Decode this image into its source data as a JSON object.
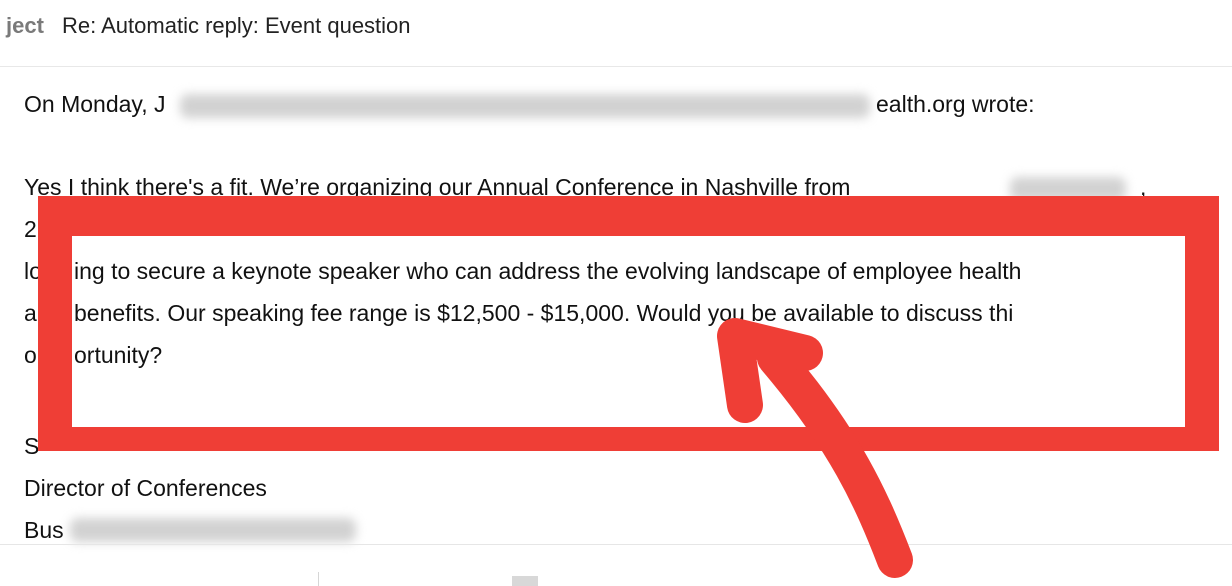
{
  "subject": {
    "label": "ject",
    "text": "Re: Automatic reply: Event question"
  },
  "email": {
    "header_start": "On Monday, J",
    "header_end": "ealth.org wrote:",
    "line1_start": "Yes I think there's a fit. We’re organizing our Annual Conference in Nashville from",
    "line1_end": ",",
    "line2_start": "2",
    "line3_start": "lo",
    "line3_main": "ing to secure a keynote speaker who can address the evolving landscape of employee health",
    "line4_start": "a",
    "line4_main": "benefits. Our speaking fee range is $12,500 - $15,000. Would you be available to discuss thi",
    "line5_start": "o",
    "line5_main": "ortunity?",
    "sig_initial": "S",
    "sig_title": "Director of Conferences",
    "sig_org_start": "Bus"
  },
  "annotation": {
    "box_color": "#ef3e36",
    "arrow_color": "#ef3e36"
  }
}
